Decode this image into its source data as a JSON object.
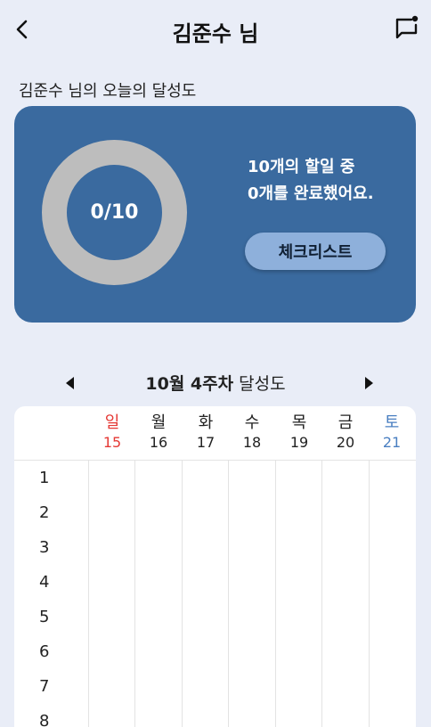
{
  "header": {
    "title": "김준수 님",
    "back_icon": "chevron-left-icon",
    "chat_icon": "chat-notification-icon"
  },
  "achievement": {
    "label": "김준수 님의 오늘의 달성도",
    "progress_text": "0/10",
    "completed": 0,
    "total": 10,
    "summary_line1": "10개의 할일 중",
    "summary_line2": "0개를 완료했어요.",
    "checklist_button": "체크리스트",
    "card_color": "#3a6a9f",
    "ring_color": "#bdbdbd"
  },
  "weekly": {
    "title_bold": "10월 4주차",
    "title_rest": " 달성도",
    "days": [
      {
        "name": "일",
        "date": "15"
      },
      {
        "name": "월",
        "date": "16"
      },
      {
        "name": "화",
        "date": "17"
      },
      {
        "name": "수",
        "date": "18"
      },
      {
        "name": "목",
        "date": "19"
      },
      {
        "name": "금",
        "date": "20"
      },
      {
        "name": "토",
        "date": "21"
      }
    ],
    "rows": [
      "1",
      "2",
      "3",
      "4",
      "5",
      "6",
      "7",
      "8"
    ],
    "sunday_color": "#e53935",
    "saturday_color": "#4a7fc1"
  }
}
